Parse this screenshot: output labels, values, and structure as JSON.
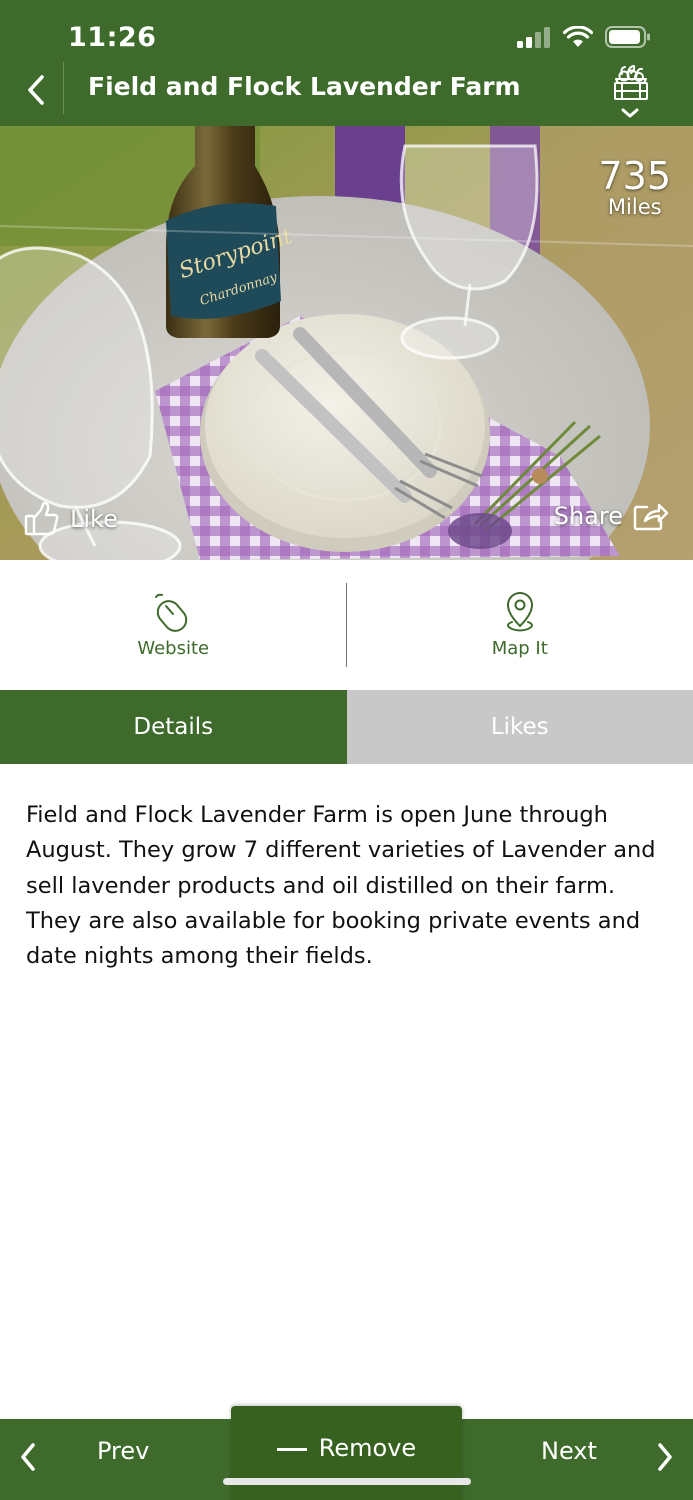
{
  "status_bar": {
    "time": "11:26"
  },
  "header": {
    "title": "Field and Flock Lavender Farm"
  },
  "hero": {
    "distance_value": "735",
    "distance_unit": "Miles",
    "like_label": "Like",
    "share_label": "Share",
    "wine_label_brand": "Storypoint",
    "wine_label_variety": "Chardonnay"
  },
  "actions": {
    "website_label": "Website",
    "map_label": "Map It"
  },
  "tabs": {
    "details_label": "Details",
    "likes_label": "Likes"
  },
  "details": {
    "text": "Field and Flock Lavender Farm is open June through August. They grow 7 different varieties of Lavender and sell lavender products and oil distilled on their farm. They are also available for booking private events and date nights among their fields."
  },
  "bottom_nav": {
    "prev_label": "Prev",
    "remove_label": "Remove",
    "next_label": "Next"
  },
  "colors": {
    "brand_green": "#3e6b2c",
    "tab_inactive": "#c8c8c8"
  }
}
